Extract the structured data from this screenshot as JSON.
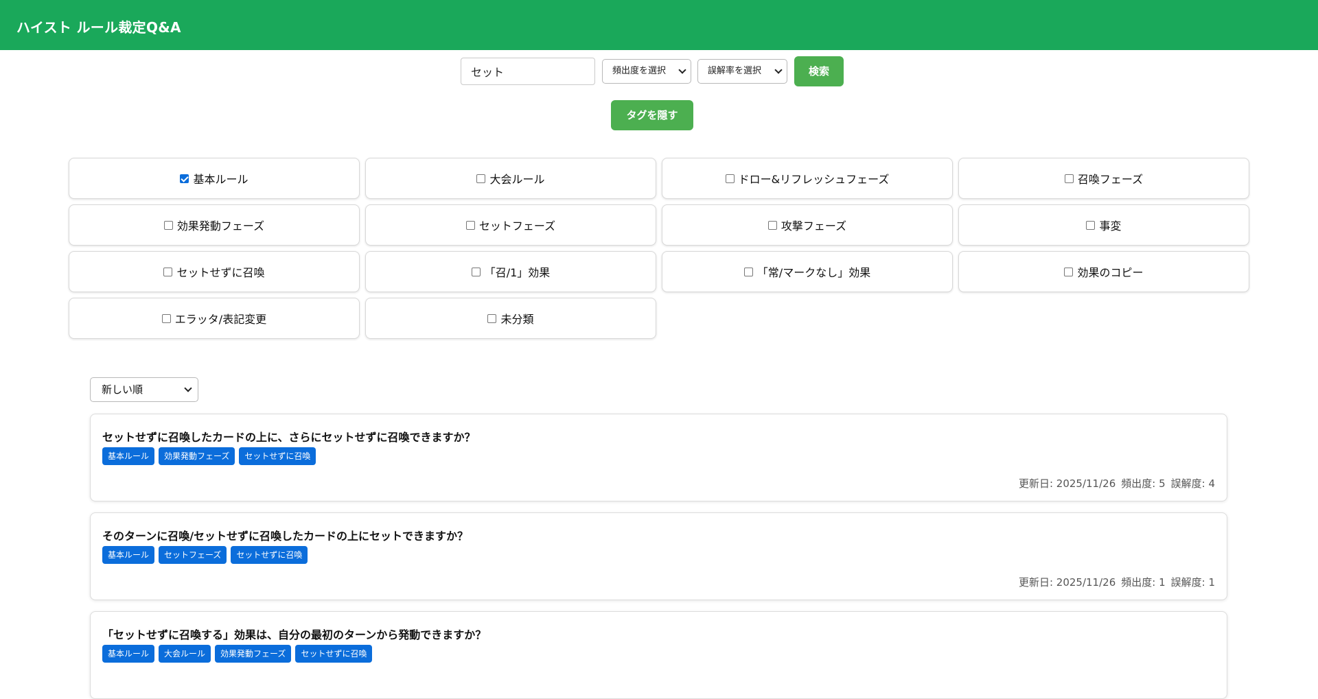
{
  "header": {
    "title": "ハイスト ルール裁定Q&A"
  },
  "search": {
    "value": "セット",
    "frequency_select": "頻出度を選択",
    "misread_select": "誤解率を選択",
    "search_button": "検索",
    "hide_tags_button": "タグを隠す"
  },
  "tags": [
    {
      "label": "基本ルール",
      "checked": true
    },
    {
      "label": "大会ルール",
      "checked": false
    },
    {
      "label": "ドロー&リフレッシュフェーズ",
      "checked": false
    },
    {
      "label": "召喚フェーズ",
      "checked": false
    },
    {
      "label": "効果発動フェーズ",
      "checked": false
    },
    {
      "label": "セットフェーズ",
      "checked": false
    },
    {
      "label": "攻撃フェーズ",
      "checked": false
    },
    {
      "label": "事変",
      "checked": false
    },
    {
      "label": "セットせずに召喚",
      "checked": false
    },
    {
      "label": "「召/1」効果",
      "checked": false
    },
    {
      "label": "「常/マークなし」効果",
      "checked": false
    },
    {
      "label": "効果のコピー",
      "checked": false
    },
    {
      "label": "エラッタ/表記変更",
      "checked": false
    },
    {
      "label": "未分類",
      "checked": false
    }
  ],
  "sort": {
    "selected": "新しい順"
  },
  "results": [
    {
      "question": "セットせずに召喚したカードの上に、さらにセットせずに召喚できますか？",
      "tags": [
        "基本ルール",
        "効果発動フェーズ",
        "セットせずに召喚"
      ],
      "updated": "更新日: 2025/11/26",
      "frequency": "頻出度: 5",
      "misread": "誤解度: 4"
    },
    {
      "question": "そのターンに召喚/セットせずに召喚したカードの上にセットできますか？",
      "tags": [
        "基本ルール",
        "セットフェーズ",
        "セットせずに召喚"
      ],
      "updated": "更新日: 2025/11/26",
      "frequency": "頻出度: 1",
      "misread": "誤解度: 1"
    },
    {
      "question": "「セットせずに召喚する」効果は、自分の最初のターンから発動できますか？",
      "tags": [
        "基本ルール",
        "大会ルール",
        "効果発動フェーズ",
        "セットせずに召喚"
      ],
      "updated": "",
      "frequency": "",
      "misread": ""
    }
  ]
}
